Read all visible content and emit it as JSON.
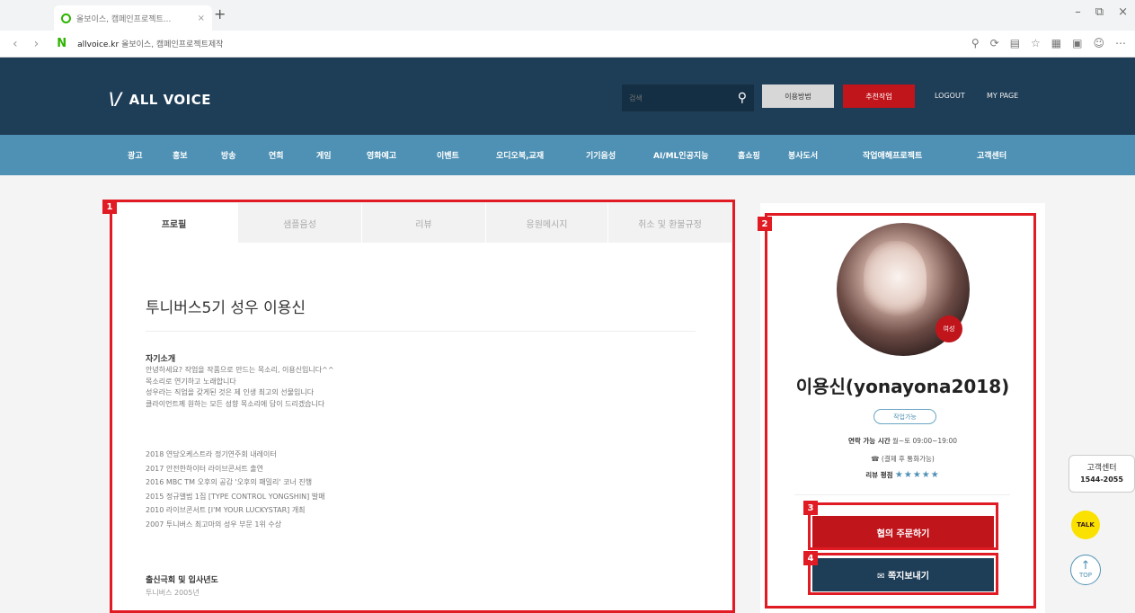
{
  "browser": {
    "tab_title": "올보이스, 캠페인프로젝트...",
    "tab_close": "×",
    "new_tab": "+",
    "naver_logo": "N",
    "url_domain": "allvoice.kr",
    "url_title": "올보이스, 캠페인프로젝트제작",
    "back_icon": "‹",
    "forward_icon": "›",
    "win_minimize": "–",
    "win_restore": "⧉",
    "win_close": "×"
  },
  "header": {
    "logo_mark": "\\/",
    "logo_text": "ALL VOICE",
    "search_placeholder": "검색",
    "search_icon": "🔍",
    "howto_label": "이용방법",
    "voice_work_label": "추천작업",
    "logout_label": "LOGOUT",
    "mypage_label": "MY PAGE"
  },
  "gnb": {
    "items": [
      "광고",
      "홍보",
      "방송",
      "연희",
      "게임",
      "영화예고",
      "이벤트",
      "오디오북,교재",
      "기기음성",
      "AI/ML인공지능",
      "홈쇼핑",
      "봉사도서",
      "작업애해프로젝트",
      "고객센터"
    ]
  },
  "profile_tabs": [
    "프로필",
    "샘플음성",
    "리뷰",
    "응원메시지",
    "취소 및 환불규정"
  ],
  "profile": {
    "title": "투니버스5기 성우 이용신",
    "intro_heading": "자기소개",
    "intro_lines": [
      "안녕하세요? 작업을 작품으로 만드는 목소리, 이용신입니다^^",
      "목소리로 연기하고 노래합니다",
      "성우라는 직업을 갖게된 것은 제 인생 최고의 선물입니다",
      "클라이언트께 원하는 모든 성향 목소리에 답이 드리겠습니다"
    ],
    "history_lines": [
      "2018 연당오케스트라 정기연주회 내레이터",
      "2017 안전한하이터 라이브콘서트 출연",
      "2016 MBC TM 오후의 공감 '오후의 패밀리' 코너 진행",
      "2015 정규앨범 1집 [TYPE CONTROL YONGSHIN] 발매",
      "2010 라이브콘서트 [I'M YOUR LUCKYSTAR] 개최",
      "2007 투니버스 최고마의 성우 부문 1위 수상"
    ],
    "origin_heading": "출신극회 및 입사년도",
    "origin_value": "투니버스 2005년"
  },
  "side": {
    "gender_badge": "여성",
    "name": "이용신(yonayona2018)",
    "availability": "작업가능",
    "contact_label": "연락 가능 시간",
    "contact_value": "월~토 09:00~19:00",
    "phone_note": "(결제 후 통화가능)",
    "phone_icon": "☎",
    "review_label": "리뷰 평점",
    "stars": "★★★★★",
    "order_button": "협의 주문하기",
    "note_button": "쪽지보내기",
    "note_icon": "✉"
  },
  "annotations": [
    "1",
    "2",
    "3",
    "4"
  ],
  "widgets": {
    "cs_line1": "고객센터",
    "cs_line2": "1544-2055",
    "talk": "TALK",
    "top_arrow": "↑",
    "top_label": "TOP"
  },
  "colors": {
    "header_bg": "#1e3d57",
    "gnb_bg": "#4f91b4",
    "accent_red": "#c1151c",
    "annotation_red": "#e01b24"
  }
}
